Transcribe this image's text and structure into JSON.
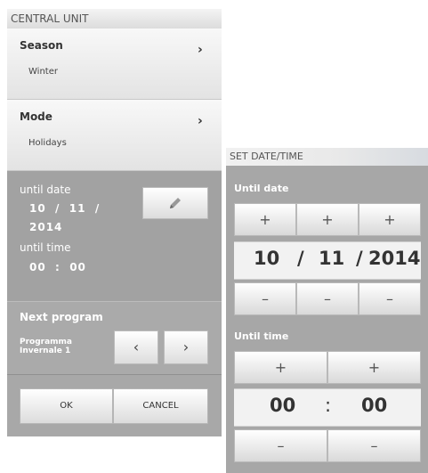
{
  "central_unit": {
    "title": "CENTRAL UNIT",
    "season": {
      "label": "Season",
      "value": "Winter",
      "chevron": "›"
    },
    "mode": {
      "label": "Mode",
      "value": "Holidays",
      "chevron": "›"
    },
    "until_date_label": "until date",
    "until_date_line1": "10  /  11  /",
    "until_date_line2": "2014",
    "until_time_label": "until time",
    "until_time_value": "00  :  00",
    "edit_icon": "pencil-icon",
    "next_program": {
      "label": "Next program",
      "value": "Programma Invernale 1",
      "prev": "‹",
      "next": "›"
    },
    "ok_label": "OK",
    "cancel_label": "CANCEL"
  },
  "set_datetime": {
    "title": "SET DATE/TIME",
    "until_date_label": "Until date",
    "until_time_label": "Until time",
    "plus": "+",
    "minus": "–",
    "date": {
      "day": "10",
      "sep1": "/",
      "month": "11",
      "sep2": "/",
      "year": "2014"
    },
    "time": {
      "hours": "00",
      "sep": ":",
      "minutes": "00"
    }
  }
}
